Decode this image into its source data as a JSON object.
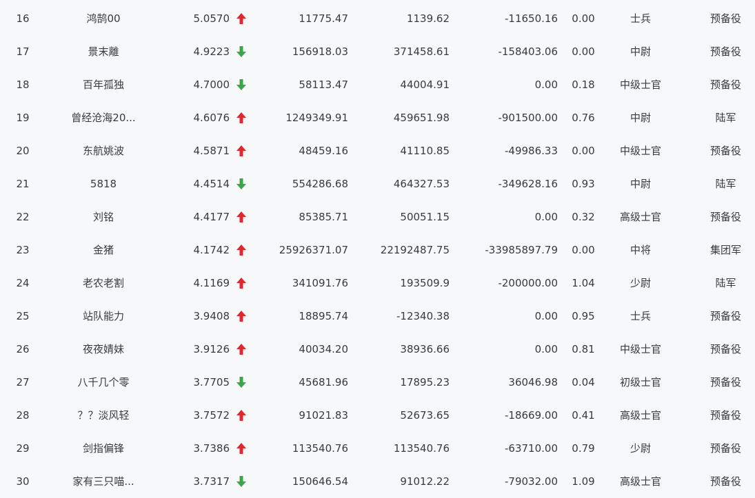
{
  "colors": {
    "up": "#e0282e",
    "down": "#3aa746",
    "text": "#3a3a3a",
    "background": "#f6f8fa"
  },
  "rows": [
    {
      "rank": "16",
      "name": "鸿鹄00",
      "score": "5.0570",
      "trend": "up",
      "v1": "11775.47",
      "v2": "1139.62",
      "v3": "-11650.16",
      "ratio": "0.00",
      "military_rank": "士兵",
      "unit": "预备役"
    },
    {
      "rank": "17",
      "name": "景末離",
      "score": "4.9223",
      "trend": "down",
      "v1": "156918.03",
      "v2": "371458.61",
      "v3": "-158403.06",
      "ratio": "0.00",
      "military_rank": "中尉",
      "unit": "预备役"
    },
    {
      "rank": "18",
      "name": "百年孤独",
      "score": "4.7000",
      "trend": "down",
      "v1": "58113.47",
      "v2": "44004.91",
      "v3": "0.00",
      "ratio": "0.18",
      "military_rank": "中级士官",
      "unit": "预备役"
    },
    {
      "rank": "19",
      "name": "曾经沧海20...",
      "score": "4.6076",
      "trend": "up",
      "v1": "1249349.91",
      "v2": "459651.98",
      "v3": "-901500.00",
      "ratio": "0.76",
      "military_rank": "中尉",
      "unit": "陆军"
    },
    {
      "rank": "20",
      "name": "东航姚波",
      "score": "4.5871",
      "trend": "up",
      "v1": "48459.16",
      "v2": "41110.85",
      "v3": "-49986.33",
      "ratio": "0.00",
      "military_rank": "中级士官",
      "unit": "预备役"
    },
    {
      "rank": "21",
      "name": "5818",
      "score": "4.4514",
      "trend": "down",
      "v1": "554286.68",
      "v2": "464327.53",
      "v3": "-349628.16",
      "ratio": "0.93",
      "military_rank": "中尉",
      "unit": "陆军"
    },
    {
      "rank": "22",
      "name": "刘铭",
      "score": "4.4177",
      "trend": "up",
      "v1": "85385.71",
      "v2": "50051.15",
      "v3": "0.00",
      "ratio": "0.32",
      "military_rank": "高级士官",
      "unit": "预备役"
    },
    {
      "rank": "23",
      "name": "金猪",
      "score": "4.1742",
      "trend": "up",
      "v1": "25926371.07",
      "v2": "22192487.75",
      "v3": "-33985897.79",
      "ratio": "0.00",
      "military_rank": "中将",
      "unit": "集团军"
    },
    {
      "rank": "24",
      "name": "老农老割",
      "score": "4.1169",
      "trend": "up",
      "v1": "341091.76",
      "v2": "193509.9",
      "v3": "-200000.00",
      "ratio": "1.04",
      "military_rank": "少尉",
      "unit": "陆军"
    },
    {
      "rank": "25",
      "name": "站队能力",
      "score": "3.9408",
      "trend": "up",
      "v1": "18895.74",
      "v2": "-12340.38",
      "v3": "0.00",
      "ratio": "0.95",
      "military_rank": "士兵",
      "unit": "预备役"
    },
    {
      "rank": "26",
      "name": "夜夜婧妹",
      "score": "3.9126",
      "trend": "up",
      "v1": "40034.20",
      "v2": "38936.66",
      "v3": "0.00",
      "ratio": "0.81",
      "military_rank": "中级士官",
      "unit": "预备役"
    },
    {
      "rank": "27",
      "name": "八千几个零",
      "score": "3.7705",
      "trend": "down",
      "v1": "45681.96",
      "v2": "17895.23",
      "v3": "36046.98",
      "ratio": "0.04",
      "military_rank": "初级士官",
      "unit": "预备役"
    },
    {
      "rank": "28",
      "name": "？？淡风轻",
      "score": "3.7572",
      "trend": "up",
      "v1": "91021.83",
      "v2": "52673.65",
      "v3": "-18669.00",
      "ratio": "0.41",
      "military_rank": "高级士官",
      "unit": "预备役"
    },
    {
      "rank": "29",
      "name": "剑指偏锋",
      "score": "3.7386",
      "trend": "up",
      "v1": "113540.76",
      "v2": "113540.76",
      "v3": "-63710.00",
      "ratio": "0.79",
      "military_rank": "少尉",
      "unit": "预备役"
    },
    {
      "rank": "30",
      "name": "家有三只喵...",
      "score": "3.7317",
      "trend": "down",
      "v1": "150646.54",
      "v2": "91012.22",
      "v3": "-79032.00",
      "ratio": "1.09",
      "military_rank": "高级士官",
      "unit": "预备役"
    }
  ]
}
